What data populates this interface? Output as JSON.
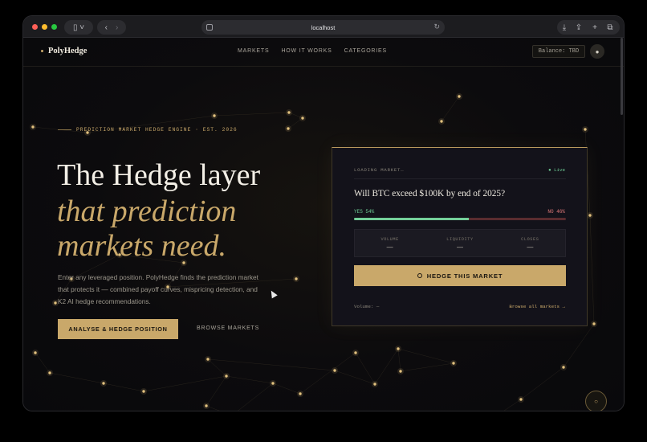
{
  "browser": {
    "address": "localhost"
  },
  "nav": {
    "brand": "PolyHedge",
    "links": [
      "MARKETS",
      "HOW IT WORKS",
      "CATEGORIES"
    ],
    "balance": "Balance: TBD"
  },
  "hero": {
    "eyebrow": "PREDICTION MARKET HEDGE ENGINE · EST. 2026",
    "title_line1": "The Hedge layer",
    "title_line2": "that prediction",
    "title_line3": "markets need.",
    "description": "Enter any leveraged position. PolyHedge finds the prediction market that protects it — combined payoff curves, mispricing detection, and K2 AI hedge recommendations.",
    "cta_primary": "ANALYSE & HEDGE POSITION",
    "cta_secondary": "BROWSE MARKETS"
  },
  "card": {
    "status": "LOADING MARKET…",
    "live": "● Live",
    "question": "Will BTC exceed $100K by end of 2025?",
    "yes_label": "YES  54%",
    "no_label": "NO  46%",
    "yes_fraction": 0.54,
    "stats": [
      {
        "label": "VOLUME",
        "value": "—"
      },
      {
        "label": "LIQUIDITY",
        "value": "—"
      },
      {
        "label": "CLOSES",
        "value": "—"
      }
    ],
    "hedge_button": "HEDGE THIS MARKET",
    "volume_text": "Volume: —",
    "browse_all": "Browse all markets →"
  },
  "colors": {
    "accent_gold": "#c9a86a",
    "yes_green": "#6fcf97",
    "no_red": "#e07a7a",
    "background": "#0b0b0f"
  },
  "icons": {
    "sidebar": "sidebar-toggle-icon",
    "back": "chevron-left-icon",
    "forward": "chevron-right-icon",
    "reload": "reload-icon",
    "download": "download-icon",
    "share": "share-icon",
    "new_tab": "plus-icon",
    "tabs": "tabs-overview-icon",
    "user": "user-icon",
    "fab": "ring-icon"
  }
}
